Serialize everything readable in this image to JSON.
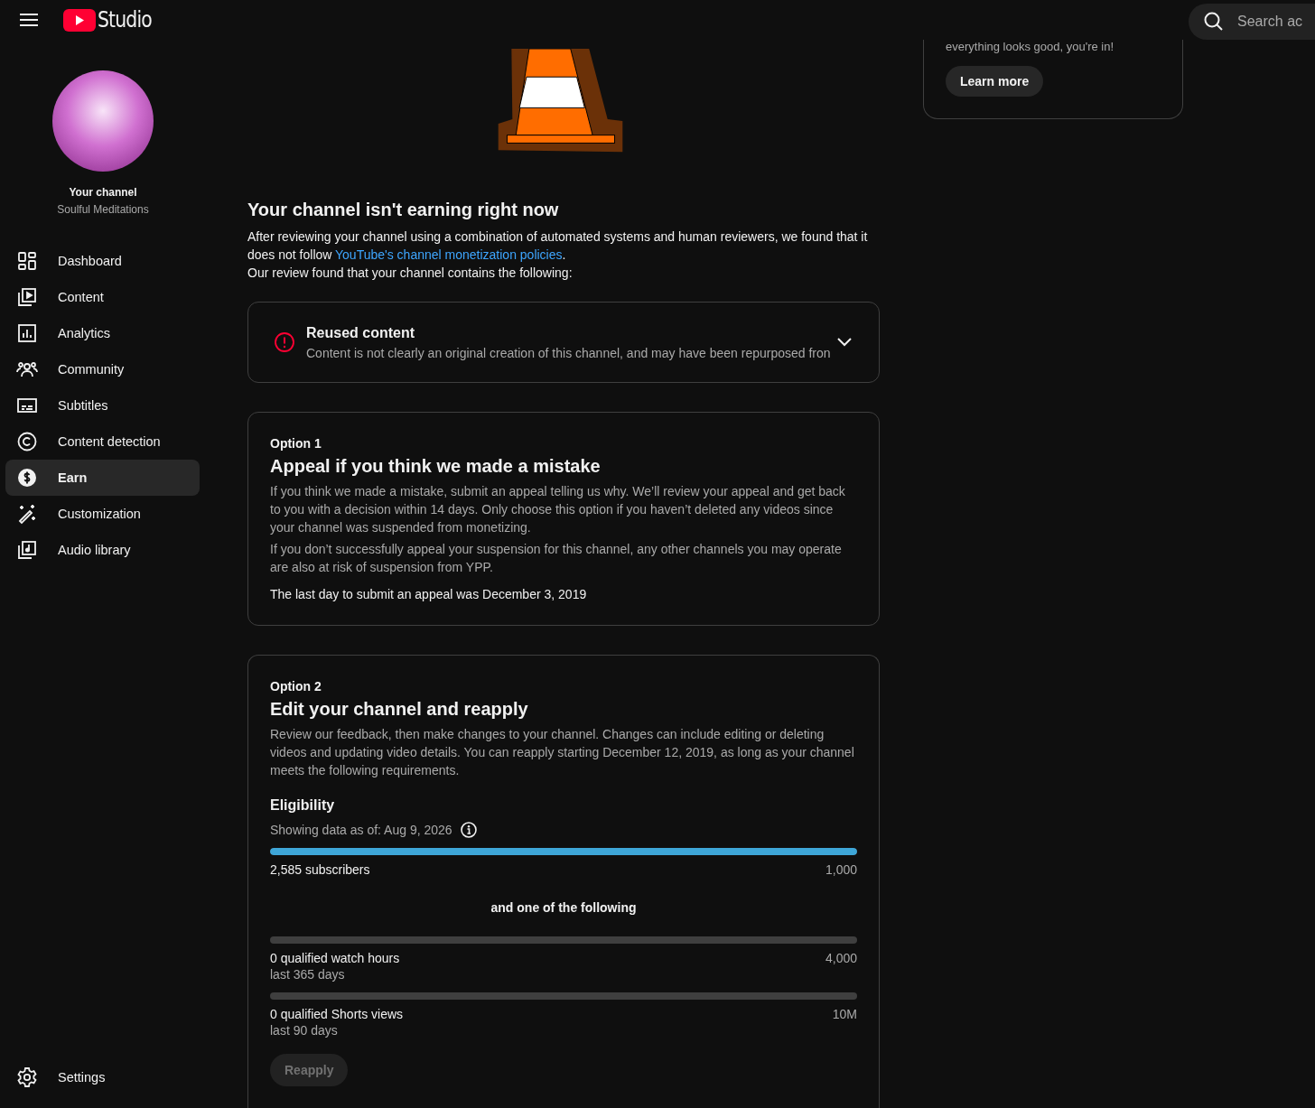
{
  "header": {
    "logo_text": "Studio",
    "search": {
      "placeholder": "Search ac"
    }
  },
  "channel": {
    "label": "Your channel",
    "name": "Soulful Meditations"
  },
  "sidebar": {
    "items": [
      {
        "label": "Dashboard",
        "selected": false
      },
      {
        "label": "Content",
        "selected": false
      },
      {
        "label": "Analytics",
        "selected": false
      },
      {
        "label": "Community",
        "selected": false
      },
      {
        "label": "Subtitles",
        "selected": false
      },
      {
        "label": "Content detection",
        "selected": false
      },
      {
        "label": "Earn",
        "selected": true
      },
      {
        "label": "Customization",
        "selected": false
      },
      {
        "label": "Audio library",
        "selected": false
      }
    ],
    "settings": {
      "label": "Settings"
    }
  },
  "status": {
    "title": "Your channel isn't earning right now",
    "intro": "After reviewing your channel using a combination of automated systems and human reviewers, we found that it does not follow ",
    "link": "YouTube's channel monetization policies",
    "intro_end": ".",
    "found": "Our review found that your channel contains the following:"
  },
  "issues": [
    {
      "title": "Reused content",
      "description": "Content is not clearly an original creation of this channel, and may have been repurposed fron",
      "expanded": false
    }
  ],
  "option1": {
    "label": "Option 1",
    "title": "Appeal if you think we made a mistake",
    "paragraphs": [
      "If you think we made a mistake, submit an appeal telling us why. We’ll review your appeal and get back to you with a decision within 14 days. Only choose this option if you haven’t deleted any videos since your channel was suspended from monetizing.",
      "If you don’t successfully appeal your suspension for this channel, any other channels you may operate are also at risk of suspension from YPP."
    ],
    "deadline": "The last day to submit an appeal was December 3, 2019"
  },
  "option2": {
    "label": "Option 2",
    "title": "Edit your channel and reapply",
    "description": "Review our feedback, then make changes to your channel. Changes can include editing or deleting videos and updating video details. You can reapply starting December 12, 2019, as long as your channel meets the following requirements.",
    "eligibility": {
      "title": "Eligibility",
      "date": "Showing data as of: Aug 9, 2026",
      "requirements": [
        {
          "label": "2,585 subscribers",
          "target": "1,000",
          "level": 1
        }
      ],
      "separator": "and one of the following",
      "alternatives": [
        {
          "label": "0 qualified watch hours",
          "period": "last 365 days",
          "target": "4,000",
          "level": 0
        },
        {
          "label": "0 qualified Shorts views",
          "period": "last 90 days",
          "target": "10M",
          "level": 0
        }
      ]
    },
    "button": {
      "label": "Reapply",
      "disabled": true
    }
  },
  "side_card": {
    "text": "everything looks good, you're in!",
    "button": "Learn more"
  }
}
